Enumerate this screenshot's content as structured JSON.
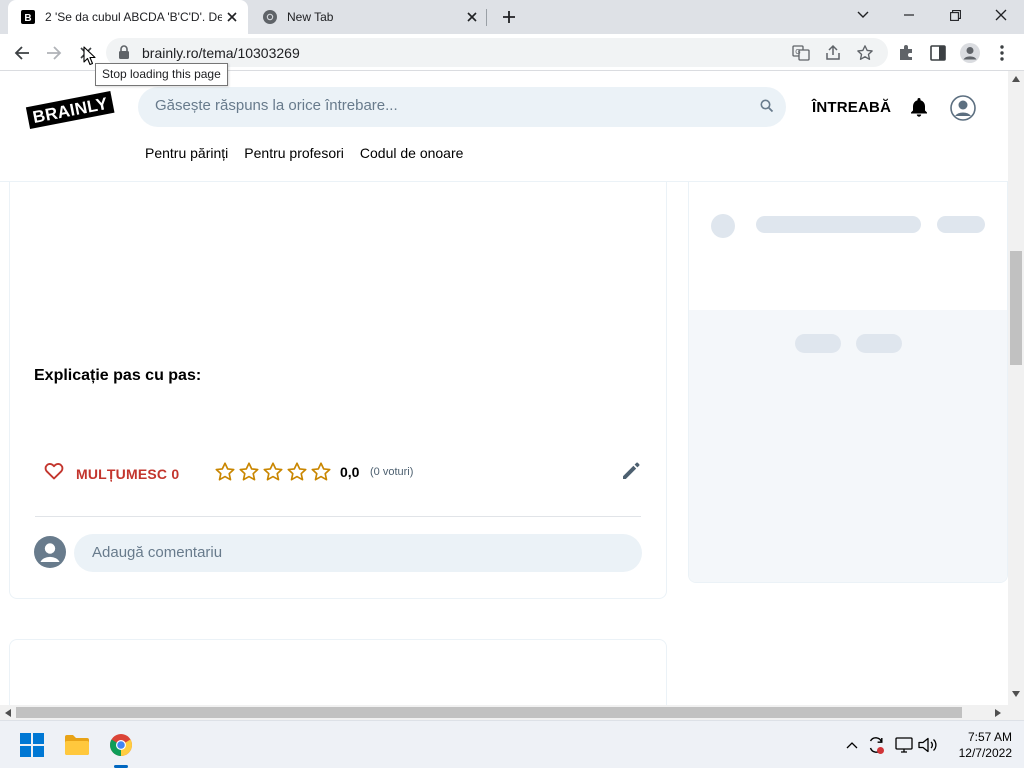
{
  "browser": {
    "tabs": [
      {
        "title": "2 'Se da cubul ABCDA 'B'C'D'. De",
        "favicon": "brainly-favicon"
      },
      {
        "title": "New Tab",
        "favicon": "chrome-favicon"
      }
    ],
    "address": "brainly.ro/tema/10303269",
    "tooltip": "Stop loading this page"
  },
  "header": {
    "logo": "BRAINLY",
    "search_placeholder": "Găsește răspuns la orice întrebare...",
    "ask_label": "ÎNTREABĂ",
    "subnav": [
      "Pentru părinți",
      "Pentru profesori",
      "Codul de onoare"
    ]
  },
  "answer": {
    "step_title": "Explicație pas cu pas:",
    "thanks_label": "MULȚUMESC 0",
    "rating": "0,0",
    "votes": "(0 voturi)",
    "stars_filled": 0,
    "stars_total": 5,
    "comment_placeholder": "Adaugă comentariu"
  },
  "taskbar": {
    "time": "7:57 AM",
    "date": "12/7/2022"
  },
  "colors": {
    "accent_red": "#c3352d",
    "star_gold": "#c98600",
    "search_bg": "#ebf2f7"
  }
}
